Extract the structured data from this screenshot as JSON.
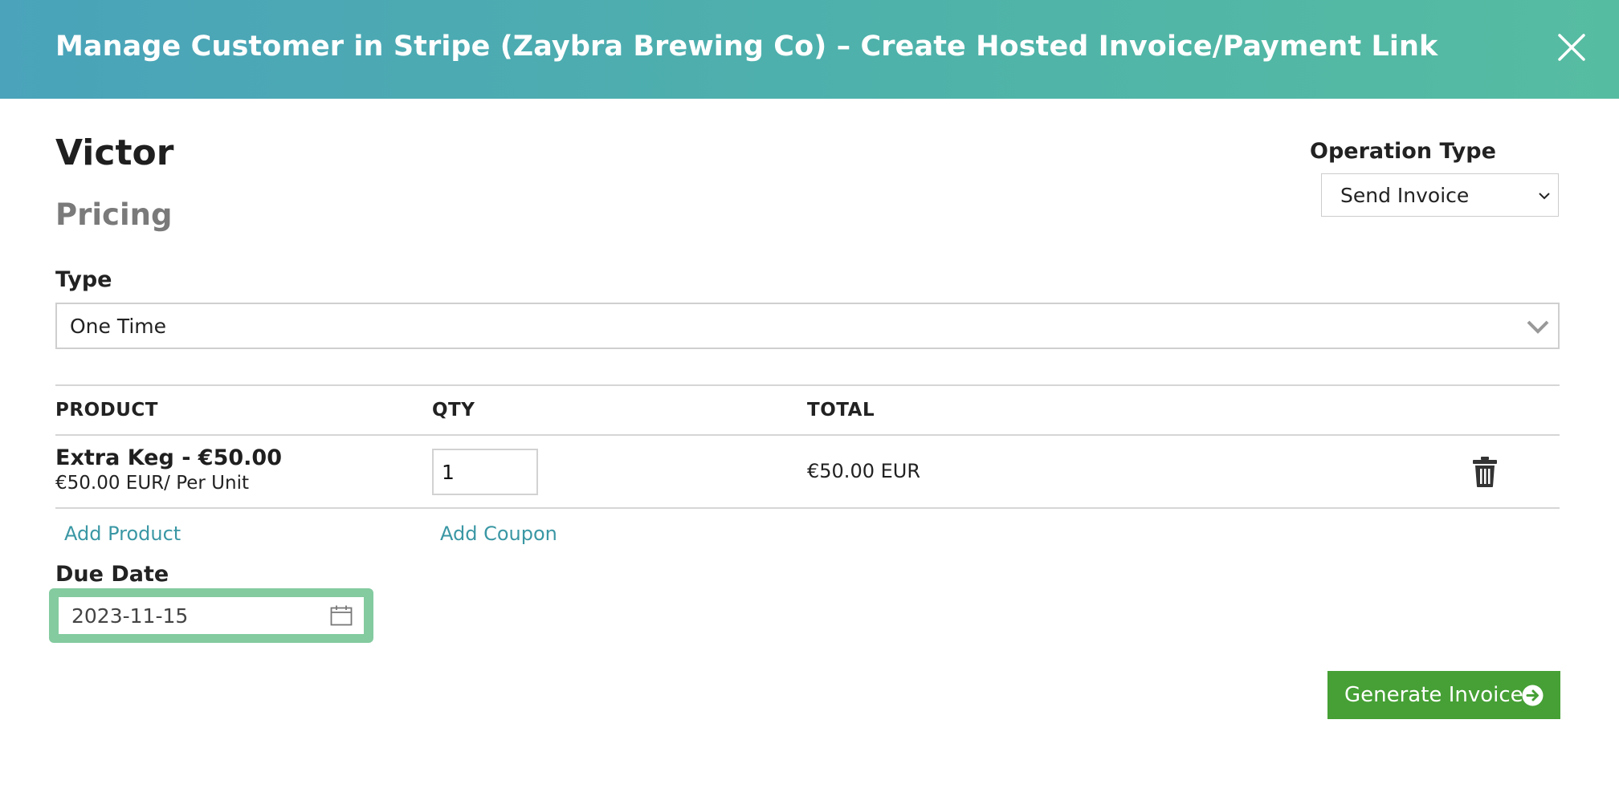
{
  "header": {
    "title": "Manage Customer in Stripe (Zaybra Brewing Co) – Create Hosted Invoice/Payment Link",
    "close_icon": "close-icon"
  },
  "customer": {
    "name": "Victor"
  },
  "pricing": {
    "title": "Pricing"
  },
  "operation": {
    "label": "Operation Type",
    "selected": "Send Invoice"
  },
  "type_field": {
    "label": "Type",
    "selected": "One Time"
  },
  "table": {
    "headers": [
      "PRODUCT",
      "QTY",
      "TOTAL"
    ],
    "rows": [
      {
        "product": "Extra Keg - €50.00",
        "unit_price": "€50.00 EUR/ Per Unit",
        "qty": "1",
        "total": "€50.00 EUR"
      }
    ]
  },
  "actions": {
    "add_product": "Add Product",
    "add_coupon": "Add Coupon"
  },
  "due_date": {
    "label": "Due Date",
    "value": "2023-11-15"
  },
  "generate_button": {
    "label": "Generate Invoice"
  },
  "colors": {
    "header_start": "#4aa3ba",
    "header_end": "#56bca1",
    "link": "#3a97a4",
    "button": "#46a035",
    "date_highlight": "#84cba0"
  }
}
